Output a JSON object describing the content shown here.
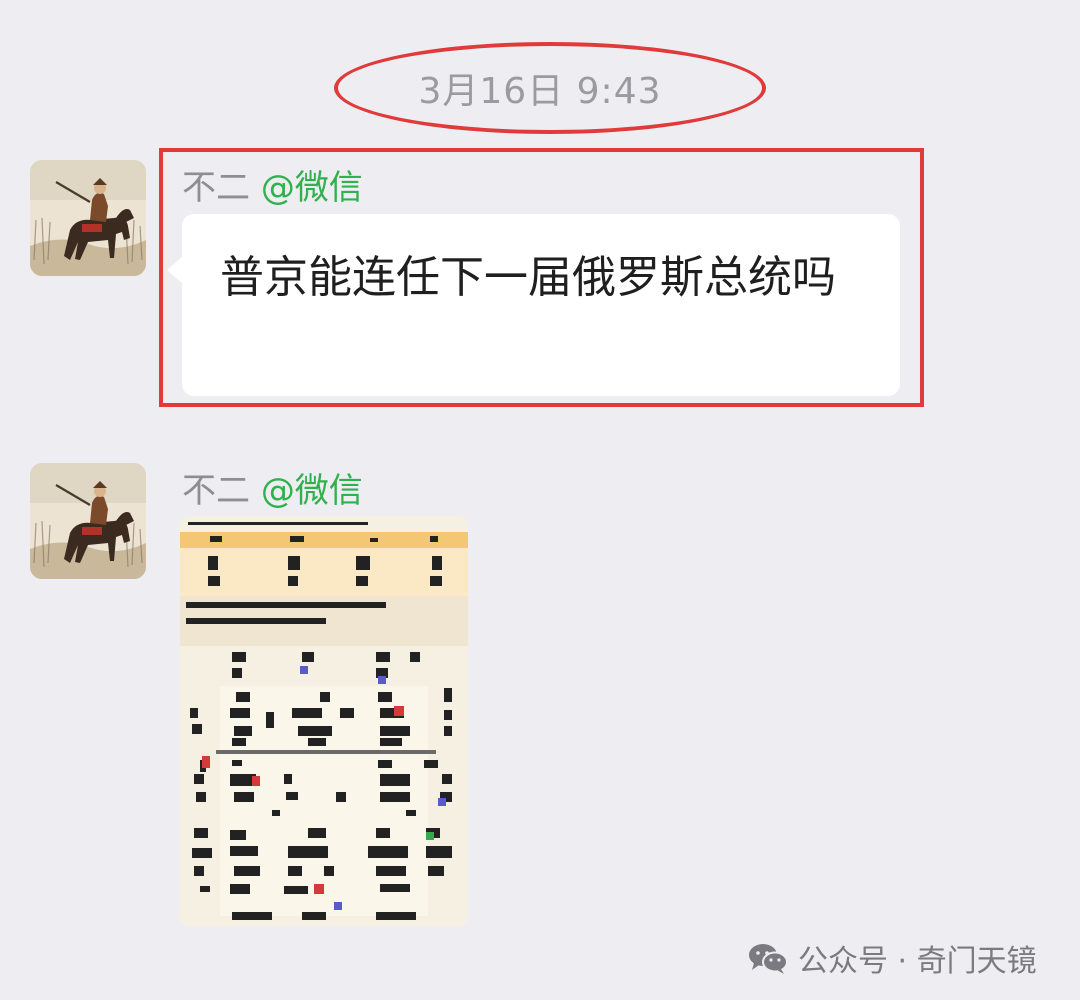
{
  "chat": {
    "timestamp": "3月16日  9:43",
    "messages": [
      {
        "sender_name": "不二",
        "sender_handle": "@微信",
        "text": "普京能连任下一届俄罗斯总统吗"
      },
      {
        "sender_name": "不二",
        "sender_handle": "@微信",
        "type": "image"
      }
    ]
  },
  "annotations": {
    "highlight_color": "#e03a3a"
  },
  "watermark": {
    "icon": "wechat-icon",
    "text": "公众号 · 奇门天镜"
  },
  "colors": {
    "background": "#ededf2",
    "handle": "#2fb14e",
    "bubble": "#ffffff"
  }
}
